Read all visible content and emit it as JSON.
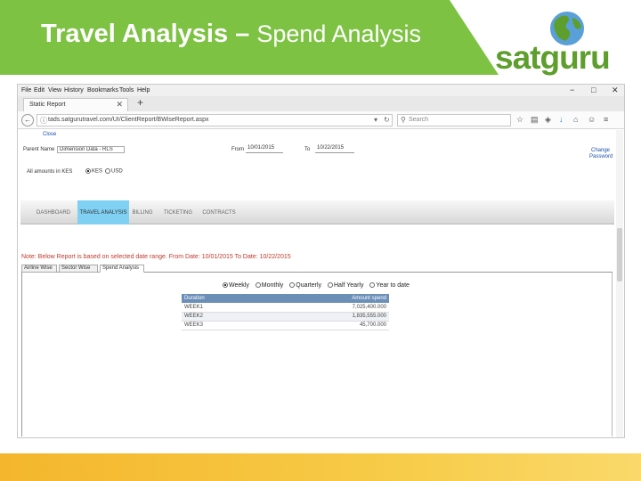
{
  "slide": {
    "title_bold": "Travel Analysis –",
    "title_light": "Spend Analysis",
    "logo_text": "satguru"
  },
  "colors": {
    "banner_green": "#7dc243",
    "logo_green": "#5e9e2c",
    "footer_gold": "#f4b62c",
    "active_tab_blue": "#7fd0f2",
    "table_header": "#6c8fb8",
    "note_red": "#c0392b"
  },
  "browser": {
    "menu": [
      "File",
      "Edit",
      "View",
      "History",
      "Bookmarks",
      "Tools",
      "Help"
    ],
    "window_controls": [
      "−",
      "□",
      "✕"
    ],
    "tab_title": "Static Report",
    "new_tab": "+",
    "url": "tads.satgurutravel.com/UI/ClientReport/BWiseReport.aspx",
    "search_placeholder": "Search"
  },
  "page": {
    "close_link": "Close",
    "client_label": "Parent Name",
    "client_value": "Dimension Data - RLS",
    "from_label": "From",
    "from_value": "10/01/2015",
    "to_label": "To",
    "to_value": "10/22/2015",
    "change_password": [
      "Change",
      "Password"
    ],
    "amounts_label": "All amounts in KES",
    "currency_options": [
      "KES",
      "USD"
    ],
    "nav_tabs": [
      "DASHBOARD",
      "TRAVEL ANALYSIS",
      "BILLING",
      "TICKETING",
      "CONTRACTS"
    ],
    "note": "Note: Below Report is based on selected date range. From Date: 10/01/2015 To Date: 10/22/2015",
    "sub_tabs": [
      "Airline Wise",
      "Sector Wise",
      "Spend Analysis"
    ],
    "period_options": [
      "Weekly",
      "Monthly",
      "Quarterly",
      "Half Yearly",
      "Year to date"
    ],
    "table": {
      "headers": [
        "Duration",
        "Amount spend"
      ],
      "rows": [
        [
          "WEEK1",
          "7,025,400.000"
        ],
        [
          "WEEK2",
          "1,835,555.000"
        ],
        [
          "WEEK3",
          "45,700.000"
        ]
      ]
    }
  }
}
